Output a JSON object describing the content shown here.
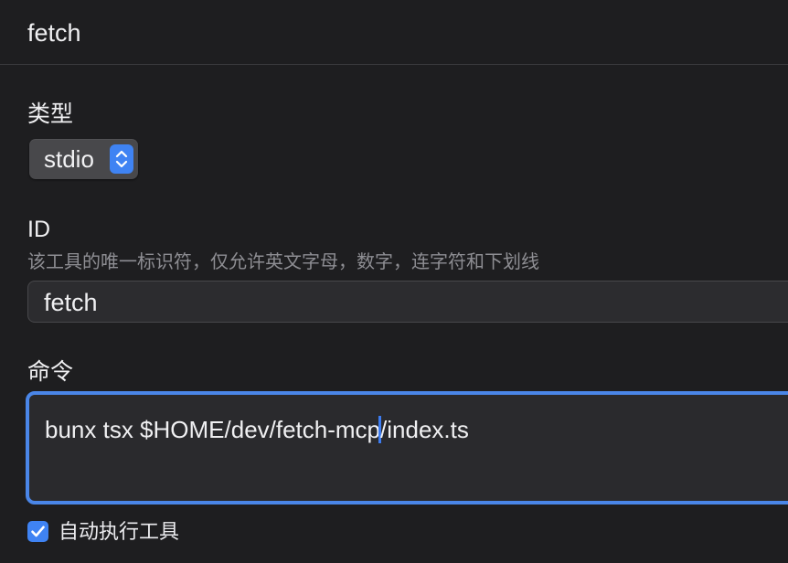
{
  "window": {
    "title": "fetch"
  },
  "form": {
    "type": {
      "label": "类型",
      "value": "stdio"
    },
    "id": {
      "label": "ID",
      "hint": "该工具的唯一标识符，仅允许英文字母，数字，连字符和下划线",
      "value": "fetch"
    },
    "command": {
      "label": "命令",
      "value_before_caret": "bunx tsx $HOME/dev/fetch-mcp",
      "value_after_caret": "/index.ts"
    },
    "auto_execute": {
      "label": "自动执行工具",
      "checked": true
    }
  },
  "colors": {
    "background": "#1e1e20",
    "accent": "#3f83f3",
    "focus_ring": "#4a86e8",
    "hint_text": "#8e8e93"
  },
  "icons": {
    "select_stepper": "chevron-up-down-icon",
    "checkbox": "checkmark-icon"
  }
}
